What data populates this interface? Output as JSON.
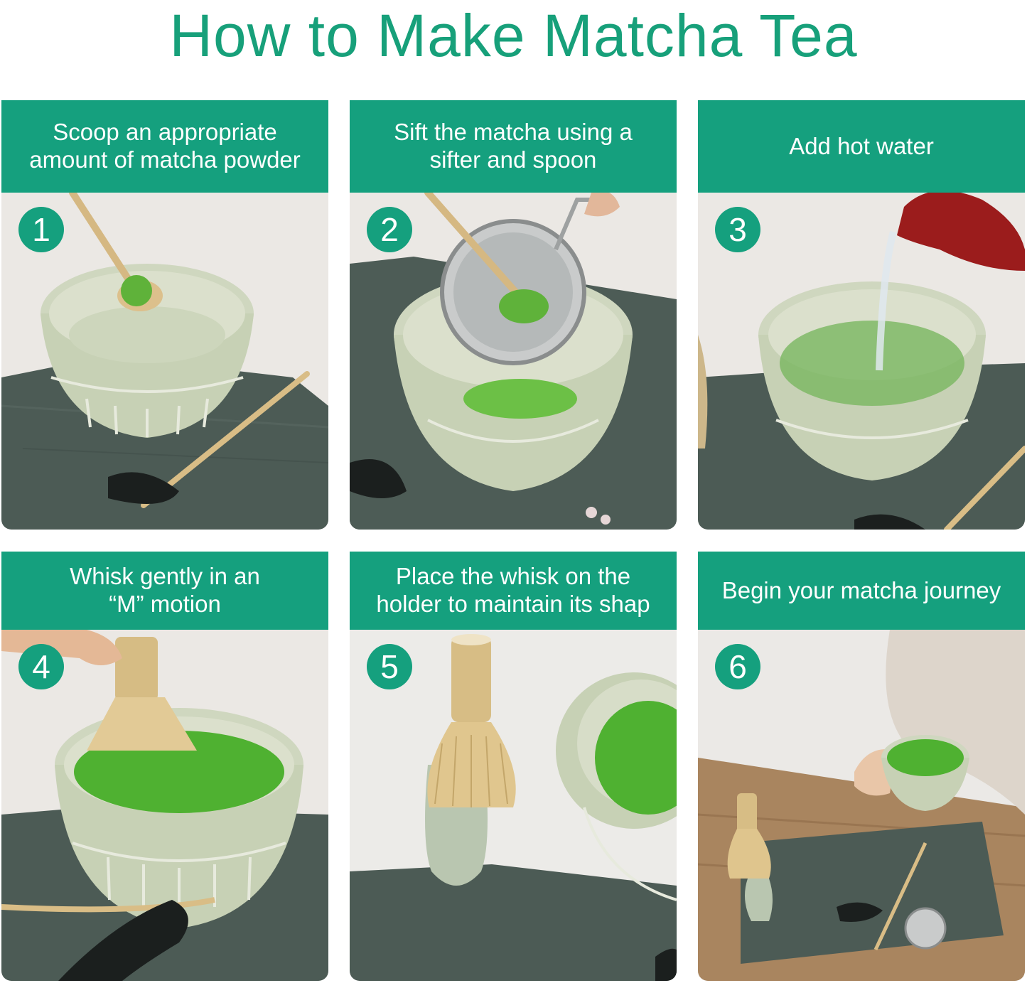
{
  "title": "How to Make Matcha Tea",
  "colors": {
    "accent": "#15a07e",
    "title": "#17a07a"
  },
  "steps": [
    {
      "number": "1",
      "text": "Scoop an appropriate\namount of matcha powder"
    },
    {
      "number": "2",
      "text": "Sift the matcha using a\nsifter and spoon"
    },
    {
      "number": "3",
      "text": "Add hot water"
    },
    {
      "number": "4",
      "text": "Whisk gently in an\n“M” motion"
    },
    {
      "number": "5",
      "text": "Place the whisk on the\nholder to maintain its shap"
    },
    {
      "number": "6",
      "text": "Begin your matcha journey"
    }
  ]
}
